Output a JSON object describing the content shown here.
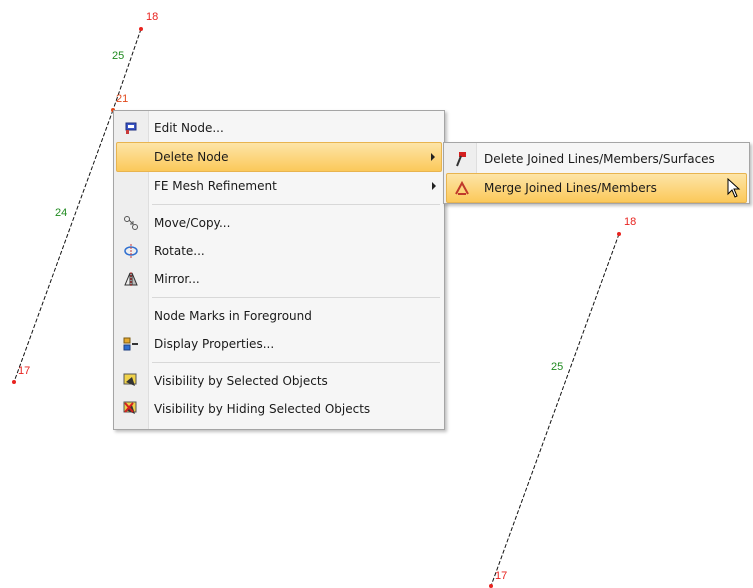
{
  "nodes": {
    "n18_top": "18",
    "n21": "21",
    "n17_left": "17",
    "n18_right": "18",
    "n17_bottom": "17"
  },
  "lines": {
    "l25_top": "25",
    "l24": "24",
    "l25_right": "25"
  },
  "context_menu": {
    "items": [
      {
        "label": "Edit Node...",
        "icon": "edit-node-icon"
      },
      {
        "label": "Delete Node",
        "icon": "",
        "submenu": true,
        "highlighted": true
      },
      {
        "label": "FE Mesh Refinement",
        "icon": "",
        "submenu": true
      },
      {
        "label": "Move/Copy...",
        "icon": "move-copy-icon"
      },
      {
        "label": "Rotate...",
        "icon": "rotate-icon"
      },
      {
        "label": "Mirror...",
        "icon": "mirror-icon"
      },
      {
        "label": "Node Marks in Foreground",
        "icon": ""
      },
      {
        "label": "Display Properties...",
        "icon": "display-properties-icon"
      },
      {
        "label": "Visibility by Selected Objects",
        "icon": "visibility-selected-icon"
      },
      {
        "label": "Visibility by Hiding Selected Objects",
        "icon": "visibility-hiding-icon"
      }
    ]
  },
  "submenu": {
    "items": [
      {
        "label": "Delete Joined Lines/Members/Surfaces",
        "icon": "delete-joined-icon"
      },
      {
        "label": "Merge Joined Lines/Members",
        "icon": "merge-joined-icon",
        "highlighted": true
      }
    ]
  },
  "colors": {
    "node_label": "#e8231f",
    "line_label": "#1f8a1f",
    "highlight": "#fbc95a"
  }
}
